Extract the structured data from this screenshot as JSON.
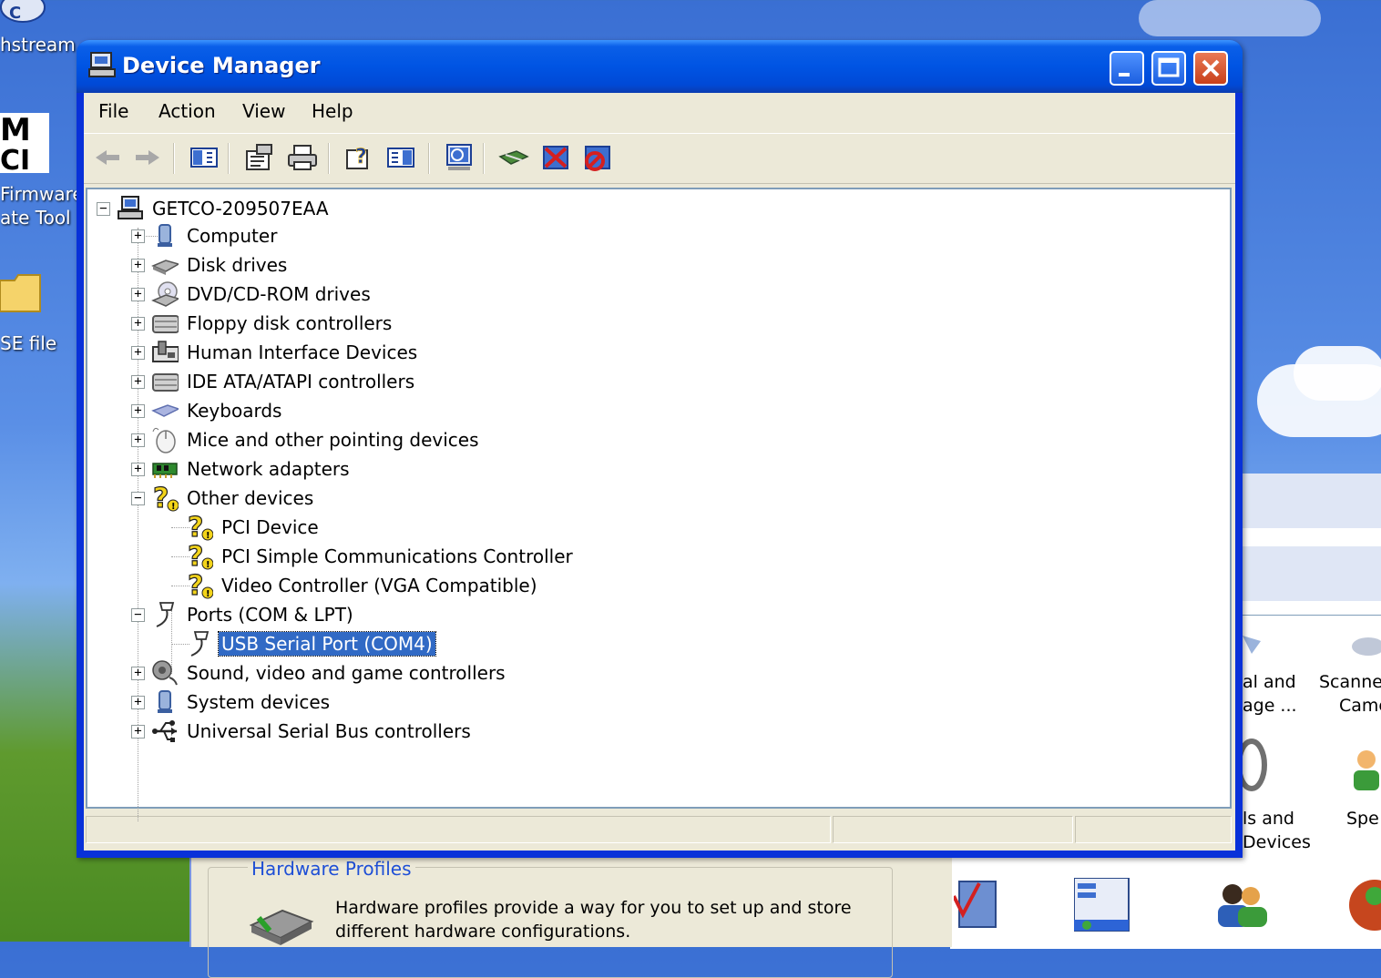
{
  "desktop": {
    "icons": [
      {
        "label": "hstream",
        "icon": "app-icon"
      },
      {
        "label_lines": [
          "Firmware",
          "ate Tool"
        ],
        "icon": "vci-icon"
      },
      {
        "label": "SE file",
        "icon": "folder-icon"
      }
    ]
  },
  "background_window": {
    "group_title": "Hardware Profiles",
    "text_lines": [
      "Hardware profiles provide a way for you to set up and store",
      "different hardware configurations."
    ]
  },
  "control_panel": {
    "items": [
      {
        "lines": [
          "al and",
          "age ..."
        ]
      },
      {
        "lines": [
          "Scanne",
          "Came"
        ]
      },
      {
        "lines": [
          "ls and",
          "Devices"
        ]
      },
      {
        "lines": [
          "Spe"
        ]
      }
    ]
  },
  "window": {
    "title": "Device Manager",
    "colors": {
      "titlebar": "#0054e3",
      "selection": "#316ac5",
      "client": "#ece9d8"
    }
  },
  "menu": [
    "File",
    "Action",
    "View",
    "Help"
  ],
  "toolbar": {
    "tools": [
      "back-icon",
      "forward-icon",
      "show-hide-console-tree-icon",
      "properties-icon",
      "print-icon",
      "help-icon",
      "show-hide-action-pane-icon",
      "scan-hardware-icon",
      "update-driver-icon",
      "uninstall-icon",
      "disable-icon"
    ]
  },
  "tree": {
    "root": "GETCO-209507EAA",
    "categories": [
      {
        "label": "Computer",
        "icon": "computer-icon",
        "expanded": false
      },
      {
        "label": "Disk drives",
        "icon": "disk-drive-icon",
        "expanded": false
      },
      {
        "label": "DVD/CD-ROM drives",
        "icon": "dvd-drive-icon",
        "expanded": false
      },
      {
        "label": "Floppy disk controllers",
        "icon": "floppy-controller-icon",
        "expanded": false
      },
      {
        "label": "Human Interface Devices",
        "icon": "hid-icon",
        "expanded": false
      },
      {
        "label": "IDE ATA/ATAPI controllers",
        "icon": "ide-controller-icon",
        "expanded": false
      },
      {
        "label": "Keyboards",
        "icon": "keyboard-icon",
        "expanded": false
      },
      {
        "label": "Mice and other pointing devices",
        "icon": "mouse-icon",
        "expanded": false
      },
      {
        "label": "Network adapters",
        "icon": "network-adapter-icon",
        "expanded": false
      },
      {
        "label": "Other devices",
        "icon": "unknown-device-icon",
        "expanded": true,
        "children": [
          "PCI Device",
          "PCI Simple Communications Controller",
          "Video Controller (VGA Compatible)"
        ]
      },
      {
        "label": "Ports (COM & LPT)",
        "icon": "port-icon",
        "expanded": true,
        "children": [
          "USB Serial Port (COM4)"
        ]
      },
      {
        "label": "Sound, video and game controllers",
        "icon": "sound-icon",
        "expanded": false
      },
      {
        "label": "System devices",
        "icon": "system-device-icon",
        "expanded": false
      },
      {
        "label": "Universal Serial Bus controllers",
        "icon": "usb-icon",
        "expanded": false
      }
    ],
    "selected": "USB Serial Port (COM4)"
  }
}
